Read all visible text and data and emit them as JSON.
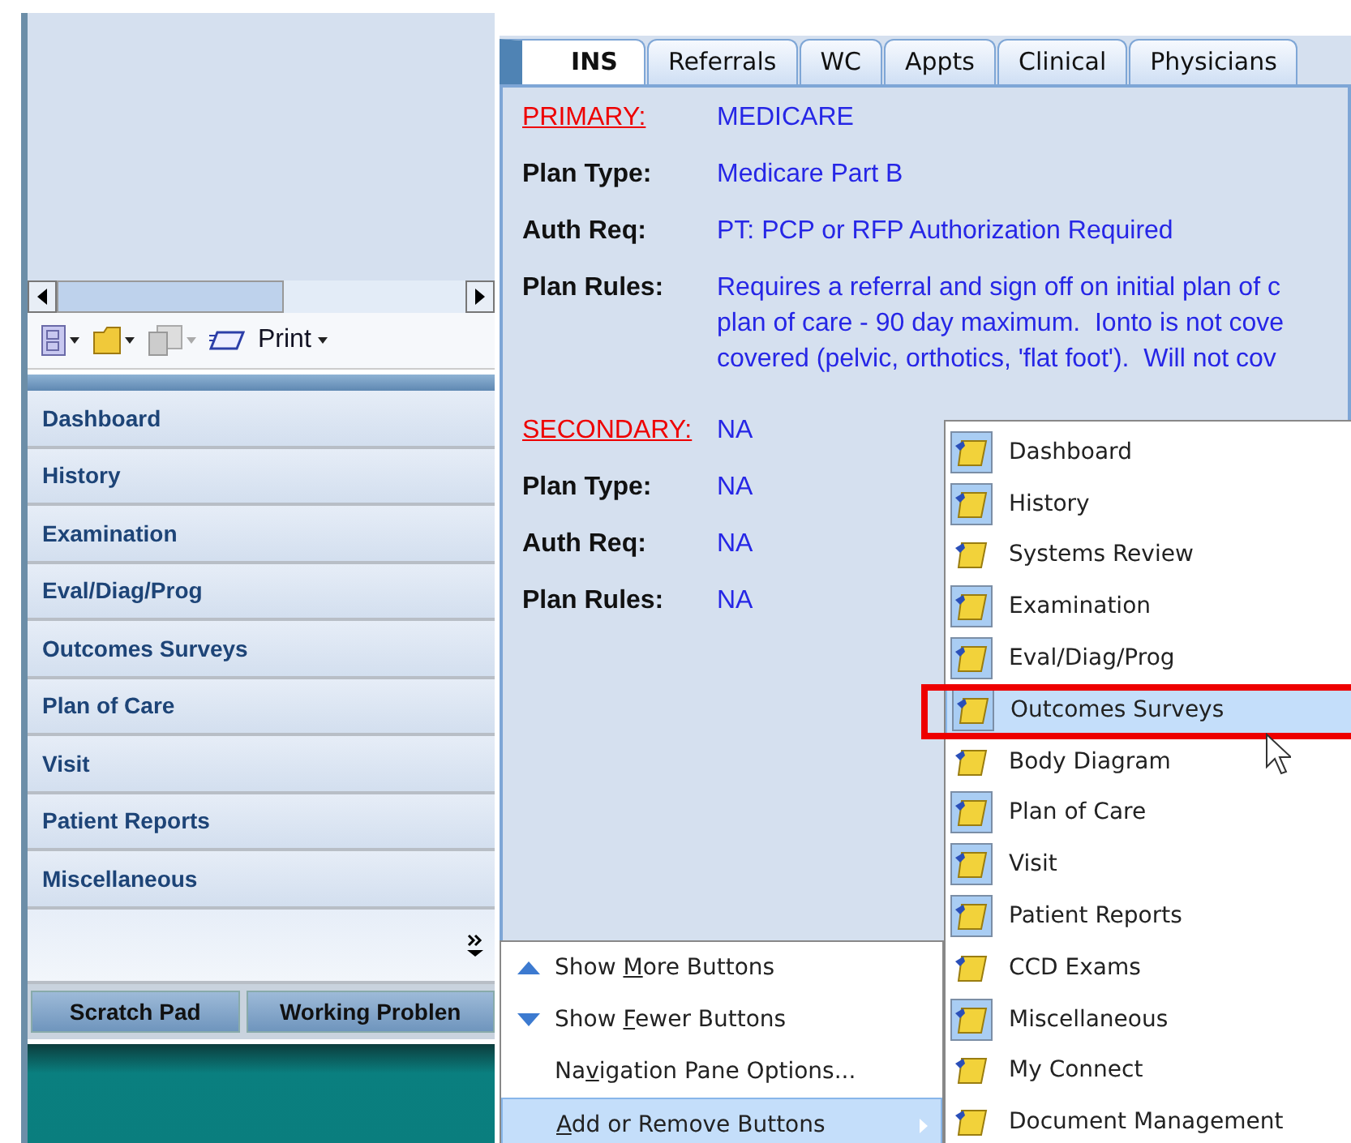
{
  "toolbar": {
    "print_label": "Print"
  },
  "nav_items": [
    {
      "label": "Dashboard"
    },
    {
      "label": "History"
    },
    {
      "label": "Examination"
    },
    {
      "label": "Eval/Diag/Prog"
    },
    {
      "label": "Outcomes Surveys"
    },
    {
      "label": "Plan of Care"
    },
    {
      "label": "Visit"
    },
    {
      "label": "Patient Reports"
    },
    {
      "label": "Miscellaneous"
    }
  ],
  "bottom_tabs": [
    {
      "label": "Scratch Pad"
    },
    {
      "label": "Working Problen"
    }
  ],
  "tabs": [
    {
      "label": "INS",
      "selected": true
    },
    {
      "label": "Referrals",
      "selected": false
    },
    {
      "label": "WC",
      "selected": false
    },
    {
      "label": "Appts",
      "selected": false
    },
    {
      "label": "Clinical",
      "selected": false
    },
    {
      "label": "Physicians",
      "selected": false
    }
  ],
  "insurance": [
    {
      "heading": "PRIMARY:",
      "name": "MEDICARE",
      "fields": [
        {
          "label": "Plan Type:",
          "value": "Medicare Part B"
        },
        {
          "label": "Auth Req:",
          "value": "PT: PCP or RFP Authorization Required"
        },
        {
          "label": "Plan Rules:",
          "value": "Requires a referral and sign off on initial plan of c\nplan of care - 90 day maximum.  Ionto is not cove\ncovered (pelvic, orthotics, 'flat foot').  Will not cov"
        }
      ]
    },
    {
      "heading": "SECONDARY:",
      "name": "NA",
      "fields": [
        {
          "label": "Plan Type:",
          "value": "NA"
        },
        {
          "label": "Auth Req:",
          "value": "NA"
        },
        {
          "label": "Plan Rules:",
          "value": "NA"
        }
      ]
    }
  ],
  "options_menu": [
    {
      "label": "Show **M**ore Buttons",
      "kind": "up"
    },
    {
      "label": "Show **F**ewer Buttons",
      "kind": "down"
    },
    {
      "label": "Na**v**igation Pane Options...",
      "kind": "plain"
    },
    {
      "label": "**A**dd or Remove Buttons",
      "kind": "submenu",
      "selected": true
    }
  ],
  "buttons_menu": [
    {
      "label": "Dashboard",
      "checked": true,
      "selected": false
    },
    {
      "label": "History",
      "checked": true,
      "selected": false
    },
    {
      "label": "Systems Review",
      "checked": false,
      "selected": false
    },
    {
      "label": "Examination",
      "checked": true,
      "selected": false
    },
    {
      "label": "Eval/Diag/Prog",
      "checked": true,
      "selected": false
    },
    {
      "label": "Outcomes Surveys",
      "checked": true,
      "selected": true,
      "annotated": true
    },
    {
      "label": "Body Diagram",
      "checked": false,
      "selected": false
    },
    {
      "label": "Plan of Care",
      "checked": true,
      "selected": false
    },
    {
      "label": "Visit",
      "checked": true,
      "selected": false
    },
    {
      "label": "Patient Reports",
      "checked": true,
      "selected": false
    },
    {
      "label": "CCD Exams",
      "checked": false,
      "selected": false
    },
    {
      "label": "Miscellaneous",
      "checked": true,
      "selected": false
    },
    {
      "label": "My Connect",
      "checked": false,
      "selected": false
    },
    {
      "label": "Document Management",
      "checked": false,
      "selected": false
    }
  ]
}
